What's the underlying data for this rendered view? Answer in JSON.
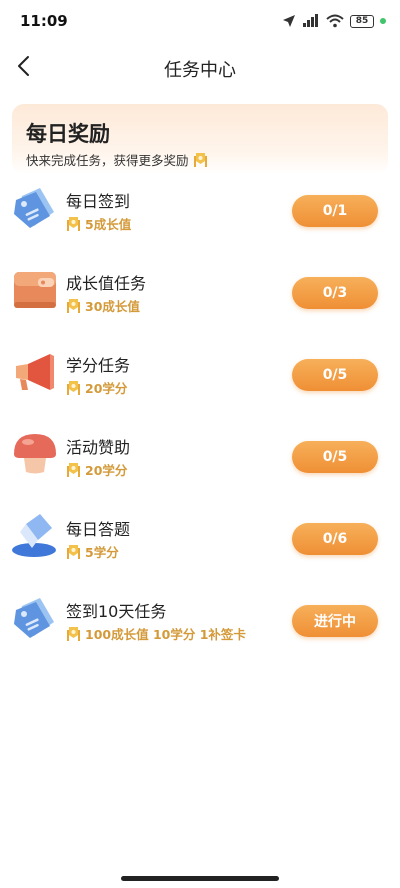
{
  "status_bar": {
    "time": "11:09",
    "battery": "85"
  },
  "nav": {
    "title": "任务中心"
  },
  "banner": {
    "title": "每日奖励",
    "subtitle": "快来完成任务，获得更多奖励"
  },
  "tasks": [
    {
      "name": "每日签到",
      "reward": "5成长值",
      "button": "0/1",
      "icon": "price-tag-icon"
    },
    {
      "name": "成长值任务",
      "reward": "30成长值",
      "button": "0/3",
      "icon": "wallet-icon"
    },
    {
      "name": "学分任务",
      "reward": "20学分",
      "button": "0/5",
      "icon": "megaphone-icon"
    },
    {
      "name": "活动赞助",
      "reward": "20学分",
      "button": "0/5",
      "icon": "mushroom-icon"
    },
    {
      "name": "每日答题",
      "reward": "5学分",
      "button": "0/6",
      "icon": "eraser-icon"
    },
    {
      "name": "签到10天任务",
      "reward": "100成长值 10学分 1补签卡",
      "button": "进行中",
      "icon": "price-tag-icon"
    }
  ],
  "colors": {
    "accent": "#f0953a",
    "reward_text": "#d49a3a",
    "banner_bg": "#fde9d8"
  }
}
